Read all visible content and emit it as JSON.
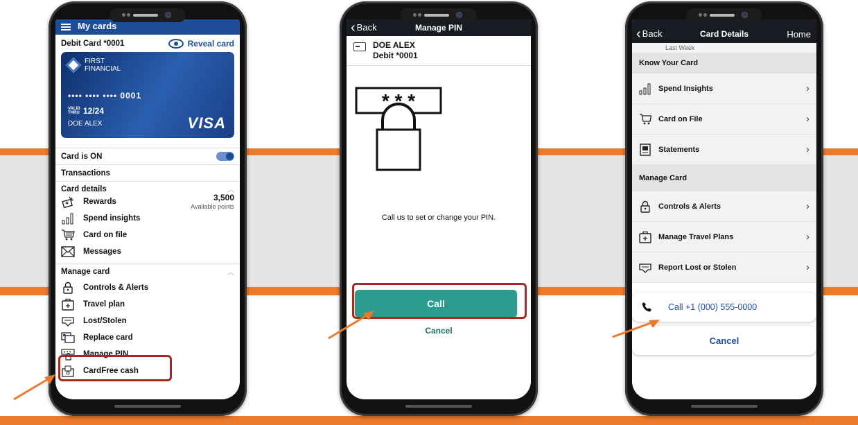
{
  "colors": {
    "brand_blue": "#1d4d97",
    "accent_orange": "#ec7a2b",
    "call_green": "#2a9d8f",
    "highlight_red": "#a5291d"
  },
  "phone1": {
    "nav_title": "My cards",
    "card_label": "Debit Card *0001",
    "reveal_label": "Reveal card",
    "card": {
      "bank_line1": "FIRST",
      "bank_line2": "FINANCIAL",
      "number": "•••• •••• •••• 0001",
      "valid_label": "VALID THRU",
      "expiry": "12/24",
      "holder": "DOE ALEX",
      "network": "VISA"
    },
    "card_status": "Card is ON",
    "transactions": "Transactions",
    "card_details_header": "Card details",
    "rewards_label": "Rewards",
    "rewards_points": "3,500",
    "rewards_sub": "Available points",
    "details_items": [
      {
        "label": "Spend insights",
        "icon": "bar-chart-icon"
      },
      {
        "label": "Card on file",
        "icon": "cart-icon"
      },
      {
        "label": "Messages",
        "icon": "envelope-icon"
      }
    ],
    "manage_header": "Manage card",
    "manage_items": [
      {
        "label": "Controls & Alerts",
        "icon": "lock-icon"
      },
      {
        "label": "Travel plan",
        "icon": "suitcase-icon"
      },
      {
        "label": "Lost/Stolen",
        "icon": "lost-card-icon"
      },
      {
        "label": "Replace card",
        "icon": "replace-card-icon"
      },
      {
        "label": "Manage PIN",
        "icon": "pin-icon"
      },
      {
        "label": "CardFree cash",
        "icon": "cash-icon"
      }
    ]
  },
  "phone2": {
    "back": "Back",
    "title": "Manage PIN",
    "account_name": "DOE ALEX",
    "account_card": "Debit *0001",
    "pin_mask": "* * *",
    "message": "Call us to set or change your PIN.",
    "call": "Call",
    "cancel": "Cancel"
  },
  "phone3": {
    "back": "Back",
    "title": "Card Details",
    "home": "Home",
    "last_week": "Last Week",
    "know_header": "Know Your Card",
    "know_items": [
      {
        "label": "Spend Insights",
        "icon": "bar-chart-icon"
      },
      {
        "label": "Card on File",
        "icon": "cart-icon"
      },
      {
        "label": "Statements",
        "icon": "statement-icon"
      }
    ],
    "manage_header": "Manage Card",
    "manage_items": [
      {
        "label": "Controls & Alerts",
        "icon": "lock-icon"
      },
      {
        "label": "Manage Travel Plans",
        "icon": "suitcase-icon"
      },
      {
        "label": "Report Lost or Stolen",
        "icon": "lost-card-icon"
      }
    ],
    "sheet_call": "Call +1 (000) 555-0000",
    "sheet_cancel": "Cancel"
  }
}
